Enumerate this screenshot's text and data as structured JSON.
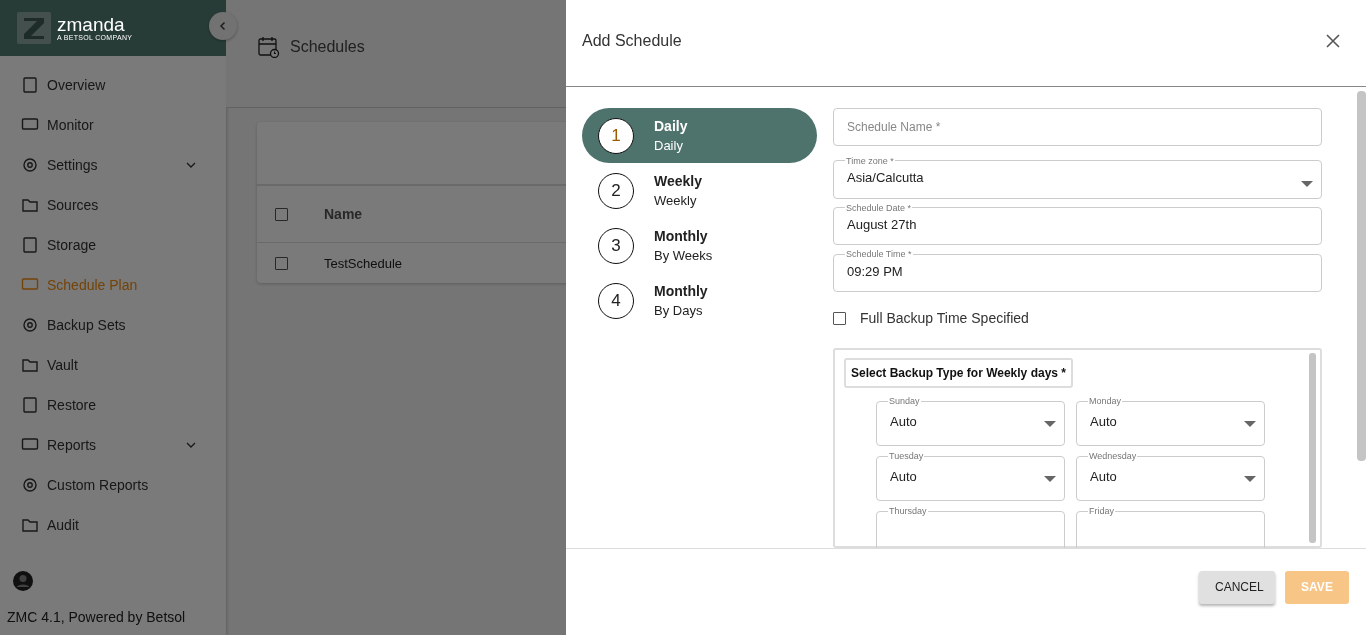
{
  "logo": {
    "name": "zmanda",
    "tagline": "A BETSOL COMPANY"
  },
  "sidebar": {
    "items": [
      {
        "label": "Overview",
        "selected": false,
        "submenu": false
      },
      {
        "label": "Monitor",
        "selected": false,
        "submenu": false
      },
      {
        "label": "Settings",
        "selected": false,
        "submenu": true
      },
      {
        "label": "Sources",
        "selected": false,
        "submenu": false
      },
      {
        "label": "Storage",
        "selected": false,
        "submenu": false
      },
      {
        "label": "Schedule Plan",
        "selected": true,
        "submenu": false
      },
      {
        "label": "Backup Sets",
        "selected": false,
        "submenu": false
      },
      {
        "label": "Vault",
        "selected": false,
        "submenu": false
      },
      {
        "label": "Restore",
        "selected": false,
        "submenu": false
      },
      {
        "label": "Reports",
        "selected": false,
        "submenu": true
      },
      {
        "label": "Custom Reports",
        "selected": false,
        "submenu": false
      },
      {
        "label": "Audit",
        "selected": false,
        "submenu": false
      }
    ],
    "footer": "ZMC 4.1, Powered by Betsol"
  },
  "page": {
    "title": "Schedules",
    "table": {
      "columns": [
        "Name"
      ],
      "rows": [
        {
          "name": "TestSchedule",
          "checked": false
        }
      ],
      "all_checked": false
    }
  },
  "dialog": {
    "title": "Add Schedule",
    "steps": [
      {
        "number": "1",
        "title": "Daily",
        "subtitle": "Daily",
        "selected": true
      },
      {
        "number": "2",
        "title": "Weekly",
        "subtitle": "Weekly",
        "selected": false
      },
      {
        "number": "3",
        "title": "Monthly",
        "subtitle": "By Weeks",
        "selected": false
      },
      {
        "number": "4",
        "title": "Monthly",
        "subtitle": "By Days",
        "selected": false
      }
    ],
    "fields": [
      {
        "kind": "text",
        "placeholder": "Schedule Name *"
      },
      {
        "kind": "select",
        "label": "Time zone *",
        "value": "Asia/Calcutta"
      },
      {
        "kind": "text",
        "label": "Schedule Date *",
        "value": "August 27th"
      },
      {
        "kind": "text",
        "label": "Schedule Time *",
        "value": "09:29 PM"
      }
    ],
    "full_backup": {
      "label": "Full Backup Time Specified",
      "checked": false
    },
    "weekly": {
      "title": "Select Backup Type for Weekly days *",
      "days": [
        {
          "label": "Sunday",
          "value": "Auto"
        },
        {
          "label": "Monday",
          "value": "Auto"
        },
        {
          "label": "Tuesday",
          "value": "Auto"
        },
        {
          "label": "Wednesday",
          "value": "Auto"
        },
        {
          "label": "Thursday"
        },
        {
          "label": "Friday"
        }
      ]
    },
    "buttons": [
      {
        "label": "CANCEL",
        "kind": "cancel",
        "disabled": false
      },
      {
        "label": "SAVE",
        "kind": "save",
        "disabled": true
      }
    ]
  }
}
